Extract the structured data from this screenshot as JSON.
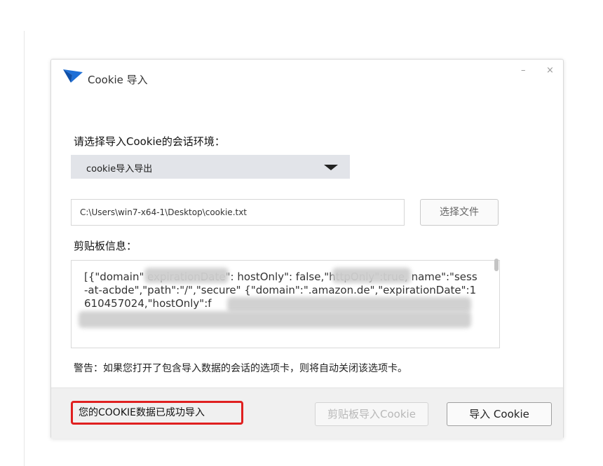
{
  "dialog": {
    "title": "Cookie 导入",
    "minimize_glyph": "–",
    "close_glyph": "×",
    "logo_icon": "bird-logo-icon",
    "accent_color": "#1e6fd6"
  },
  "env": {
    "label": "请选择导入Cookie的会话环境：",
    "selected": "cookie导入导出"
  },
  "file": {
    "path": "C:\\Users\\win7-x64-1\\Desktop\\cookie.txt",
    "choose_button": "选择文件"
  },
  "clipboard": {
    "label": "剪贴板信息：",
    "text": "[{\"domain\"               expirationDate\":              hostOnly\": false,\"httpOnly\":true, name\":\"sess-at-acbde\",\"path\":\"/\",\"secure\"                                                      {\"domain\":\".amazon.de\",\"expirationDate\":1610457024,\"hostOnly\":f"
  },
  "warning": "警告：如果您打开了包含导入数据的会话的选项卡，则将自动关闭该选项卡。",
  "footer": {
    "status": "您的COOKIE数据已成功导入",
    "status_border_color": "#e02020",
    "clipboard_import_button": "剪贴板导入Cookie",
    "import_button": "导入 Cookie"
  }
}
